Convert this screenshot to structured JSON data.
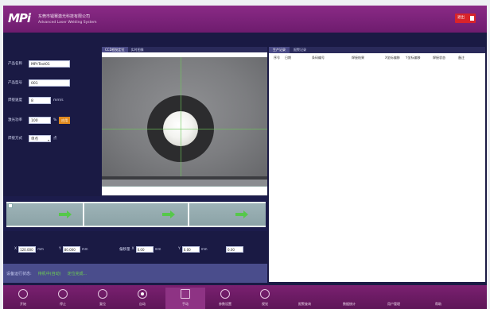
{
  "header": {
    "logo": "MPi",
    "company_cn": "东莞市镭赛激光科技有限公司",
    "company_en": "Advanced Laser Welding System",
    "exit_label": "退出"
  },
  "params": {
    "product_label": "产品名称",
    "product_value": "MPI-Test01",
    "mode_label": "产品型号",
    "mode_value": "001",
    "speed_label": "焊接速度",
    "speed_value": "8",
    "speed_unit": "mm/s",
    "power_label": "激光功率",
    "power_value": "100",
    "power_unit": "%",
    "apply_label": "应用",
    "type_label": "焊接方式",
    "type_value": "单点",
    "type_suffix": "点"
  },
  "camera": {
    "tabs": [
      "CCD视觉定位",
      "实时图像"
    ]
  },
  "records": {
    "tabs": [
      "生产记录",
      "报警记录"
    ],
    "columns": [
      "序号",
      "日期",
      "条码编号",
      "焊接结果",
      "X坐标偏移",
      "Y坐标偏移",
      "焊接状态",
      "备注"
    ]
  },
  "position": {
    "x_label": "X",
    "x_value": "120.000",
    "x_unit": "mm",
    "y_label": "Y",
    "y_value": "80.000",
    "y_unit": "mm",
    "offset_label": "偏移量",
    "dx_label": "X",
    "dx_value": "0.00",
    "dx_unit": "mm",
    "dy_label": "Y",
    "dy_value": "0.00",
    "dy_unit": "mm",
    "z_value": "0.00"
  },
  "status": {
    "label": "设备运行状态:",
    "value1": "待机中(自动)",
    "value2": "定位完成..."
  },
  "toolbar": {
    "items": [
      {
        "label": "开始"
      },
      {
        "label": "停止"
      },
      {
        "label": "复位"
      },
      {
        "label": "自动"
      },
      {
        "label": "手动"
      },
      {
        "label": "参数设置"
      },
      {
        "label": "视觉"
      },
      {
        "label": "报警查询"
      },
      {
        "label": "数据统计"
      },
      {
        "label": "用户管理"
      },
      {
        "label": "帮助"
      }
    ]
  },
  "colors": {
    "header": "#7a2274",
    "panel": "#1a1a44",
    "accent_green": "#56c84a",
    "apply_orange": "#e08a1e",
    "exit_red": "#d8232a"
  }
}
